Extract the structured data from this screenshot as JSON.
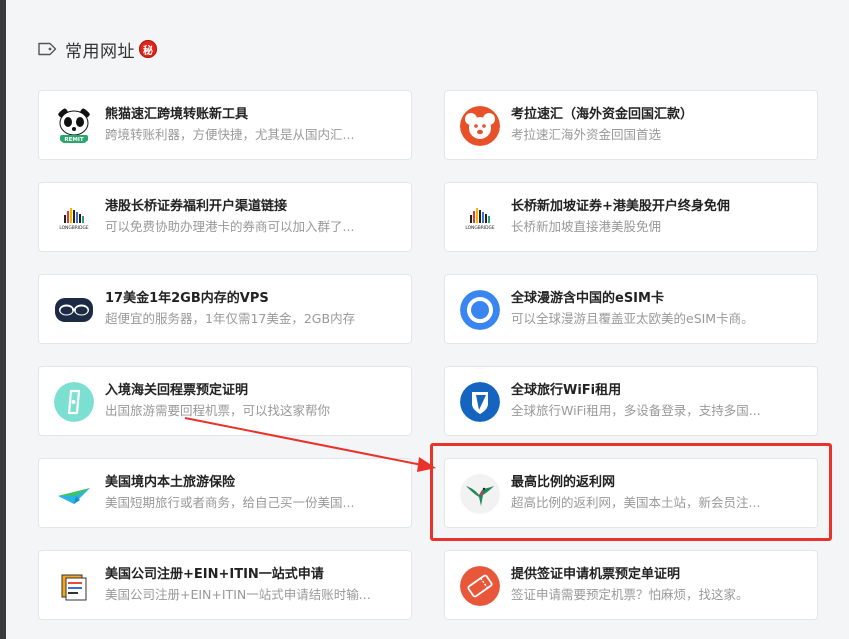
{
  "section": {
    "title": "常用网址",
    "badge": "秘",
    "icon": "tag-icon"
  },
  "accent_colors": {
    "highlight": "#e8332b",
    "badge": "#e0251b"
  },
  "cards": [
    {
      "title": "熊猫速汇跨境转账新工具",
      "desc": "跨境转账利器，方便快捷，尤其是从国内汇...",
      "logo": "panda-remit-logo",
      "logo_text": "REMIT"
    },
    {
      "title": "考拉速汇（海外资金回国汇款）",
      "desc": "考拉速汇海外资金回国首选",
      "logo": "koala-logo"
    },
    {
      "title": "港股长桥证券福利开户渠道链接",
      "desc": "可以免费协助办理港卡的券商可以加入群了...",
      "logo": "longbridge-logo",
      "logo_text": "LONGBRIDGE"
    },
    {
      "title": "长桥新加坡证券+港美股开户终身免佣",
      "desc": "长桥新加坡直接港美股免佣",
      "logo": "longbridge-logo",
      "logo_text": "LONGBRIDGE"
    },
    {
      "title": "17美金1年2GB内存的VPS",
      "desc": "超便宜的服务器，1年仅需17美金，2GB内存",
      "logo": "sunglasses-logo"
    },
    {
      "title": "全球漫游含中国的eSIM卡",
      "desc": "可以全球漫游且覆盖亚太欧美的eSIM卡商。",
      "logo": "esim-ring-logo"
    },
    {
      "title": "入境海关回程票预定证明",
      "desc": "出国旅游需要回程机票，可以找这家帮你",
      "logo": "ticket-logo"
    },
    {
      "title": "全球旅行WiFi租用",
      "desc": "全球旅行WiFi租用，多设备登录，支持多国...",
      "logo": "wifi-shield-logo"
    },
    {
      "title": "美国境内本土旅游保险",
      "desc": "美国短期旅行或者商务，给自己买一份美国...",
      "logo": "plane-wing-logo"
    },
    {
      "title": "最高比例的返利网",
      "desc": "超高比例的返利网，美国本土站，新会员注...",
      "logo": "hummingbird-logo"
    },
    {
      "title": "美国公司注册+EIN+ITIN一站式申请",
      "desc": "美国公司注册+EIN+ITIN一站式申请结账时输...",
      "logo": "documents-logo"
    },
    {
      "title": "提供签证申请机票预定单证明",
      "desc": "签证申请需要预定机票？怕麻烦，找这家。",
      "logo": "visa-ticket-logo"
    }
  ]
}
